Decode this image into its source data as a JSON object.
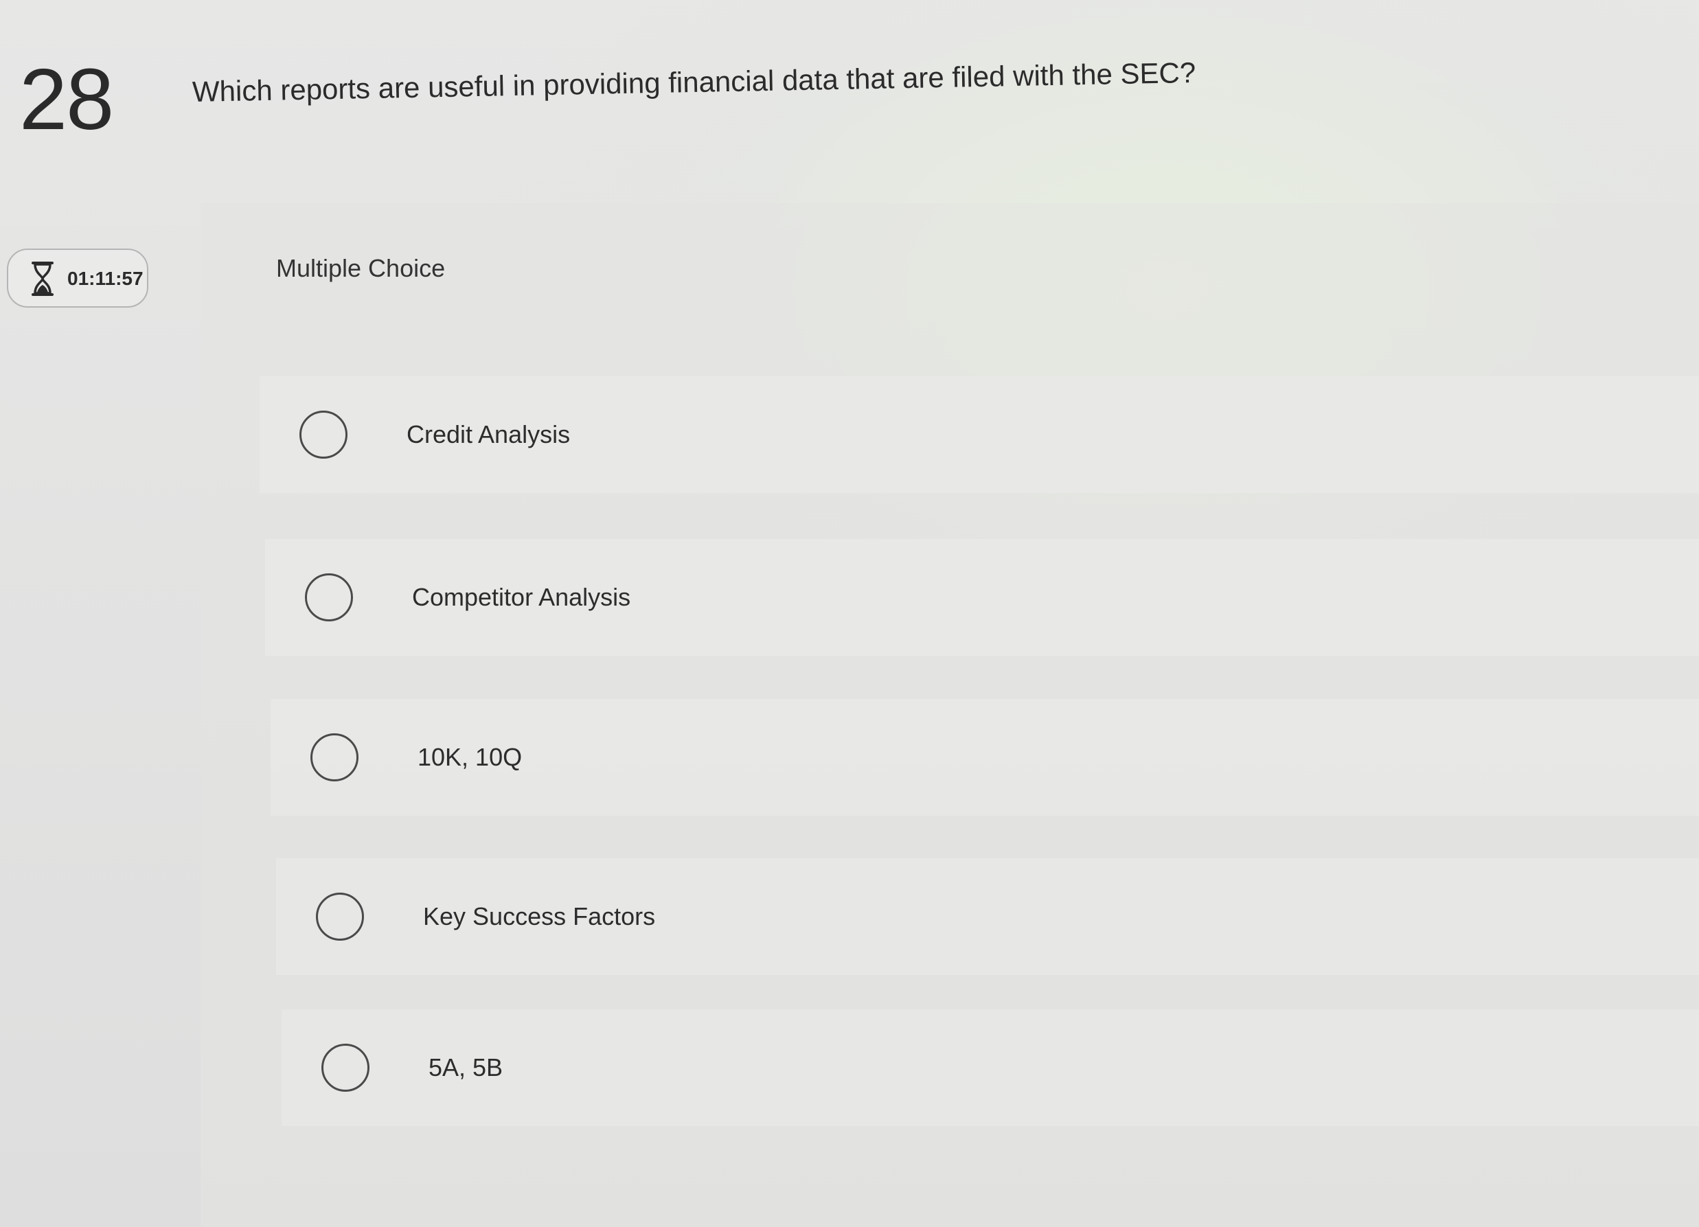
{
  "question": {
    "number": "28",
    "text": "Which reports are useful in providing financial data that are filed with the SEC?",
    "type_label": "Multiple Choice"
  },
  "timer": {
    "icon": "hourglass-icon",
    "value": "01:11:57"
  },
  "options": [
    {
      "label": "Credit Analysis",
      "selected": false
    },
    {
      "label": "Competitor Analysis",
      "selected": false
    },
    {
      "label": "10K, 10Q",
      "selected": false
    },
    {
      "label": "Key Success Factors",
      "selected": false
    },
    {
      "label": "5A, 5B",
      "selected": false
    }
  ]
}
